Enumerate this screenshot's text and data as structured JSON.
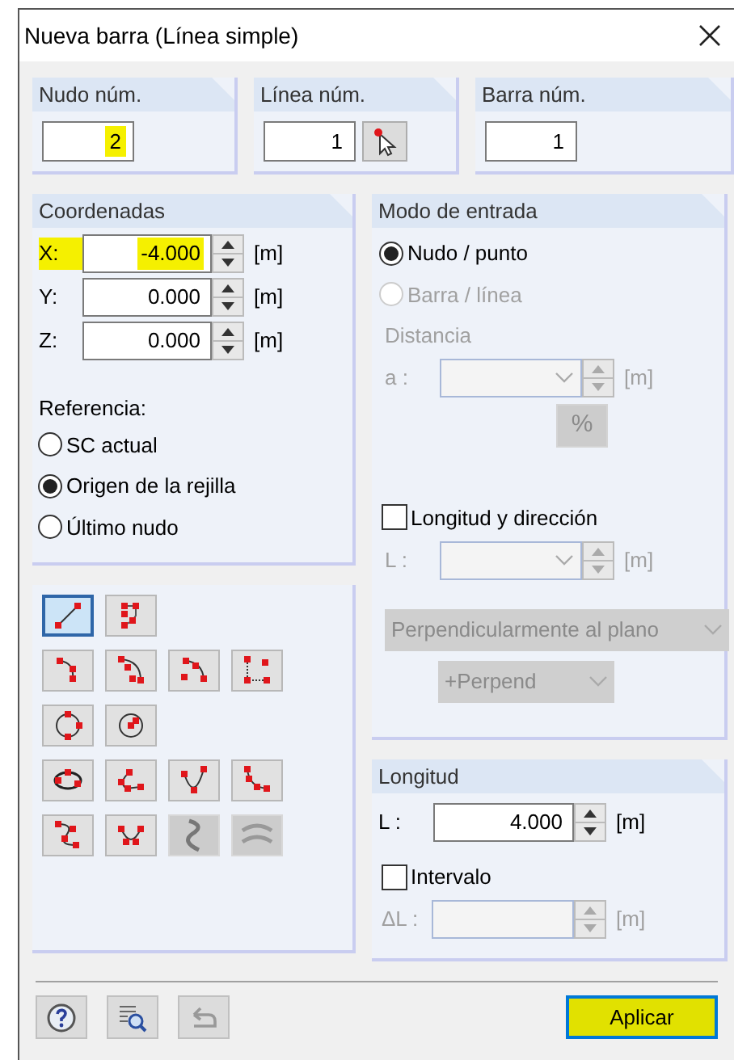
{
  "window": {
    "title": "Nueva barra (Línea simple)"
  },
  "top_boxes": [
    {
      "label": "Nudo núm.",
      "value": "2",
      "highlighted": true,
      "pick_button": false
    },
    {
      "label": "Línea núm.",
      "value": "1",
      "highlighted": false,
      "pick_button": true
    },
    {
      "label": "Barra núm.",
      "value": "1",
      "highlighted": false,
      "pick_button": false
    }
  ],
  "coordenadas": {
    "title": "Coordenadas",
    "rows": [
      {
        "label": "X:",
        "value": "-4.000",
        "unit": "[m]",
        "highlighted": true
      },
      {
        "label": "Y:",
        "value": "0.000",
        "unit": "[m]",
        "highlighted": false
      },
      {
        "label": "Z:",
        "value": "0.000",
        "unit": "[m]",
        "highlighted": false
      }
    ],
    "referencia": "Referencia:",
    "options": [
      {
        "label": "SC actual",
        "selected": false
      },
      {
        "label": "Origen de la rejilla",
        "selected": true
      },
      {
        "label": "Último nudo",
        "selected": false
      }
    ]
  },
  "tools": [
    [
      {
        "selected": true,
        "disabled": false
      },
      {
        "selected": false,
        "disabled": false
      }
    ],
    [
      {
        "selected": false,
        "disabled": false
      },
      {
        "selected": false,
        "disabled": false
      },
      {
        "selected": false,
        "disabled": false
      },
      {
        "selected": false,
        "disabled": false
      }
    ],
    [
      {
        "selected": false,
        "disabled": false
      },
      {
        "selected": false,
        "disabled": false
      }
    ],
    [
      {
        "selected": false,
        "disabled": false
      },
      {
        "selected": false,
        "disabled": false
      },
      {
        "selected": false,
        "disabled": false
      },
      {
        "selected": false,
        "disabled": false
      }
    ],
    [
      {
        "selected": false,
        "disabled": false
      },
      {
        "selected": false,
        "disabled": false
      },
      {
        "selected": false,
        "disabled": true
      },
      {
        "selected": false,
        "disabled": true
      }
    ]
  ],
  "modo": {
    "title": "Modo de entrada",
    "options": [
      {
        "label": "Nudo / punto",
        "selected": true,
        "disabled": false
      },
      {
        "label": "Barra / línea",
        "selected": false,
        "disabled": true
      }
    ],
    "distancia": "Distancia",
    "a_field": {
      "label": "a :",
      "unit": "[m]",
      "disabled": true
    },
    "percent_button": {
      "label": "%",
      "disabled": true
    },
    "longitud_direccion": {
      "label": "Longitud y dirección",
      "checked": false
    },
    "l_field": {
      "label": "L :",
      "unit": "[m]",
      "disabled": true
    },
    "plane_dropdown": {
      "value": "Perpendicularmente al plano",
      "disabled": true
    },
    "direction_dropdown": {
      "value": "+Perpend",
      "disabled": true
    }
  },
  "longitud": {
    "title": "Longitud",
    "l_field": {
      "label": "L :",
      "value": "4.000",
      "unit": "[m]",
      "disabled": false
    },
    "intervalo": {
      "label": "Intervalo",
      "checked": false
    },
    "delta_field": {
      "label": "ΔL :",
      "unit": "[m]",
      "disabled": true
    }
  },
  "footer": {
    "apply_button": {
      "label": "Aplicar",
      "highlighted": true
    }
  }
}
